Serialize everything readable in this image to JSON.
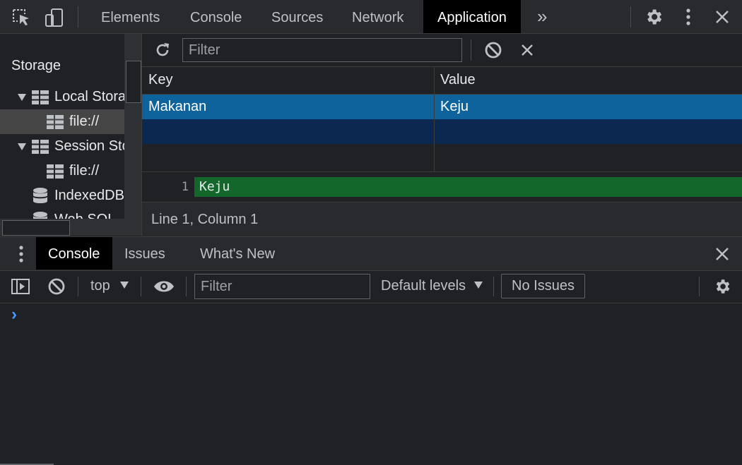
{
  "toolbar": {
    "tabs": [
      {
        "label": "Elements"
      },
      {
        "label": "Console"
      },
      {
        "label": "Sources"
      },
      {
        "label": "Network"
      },
      {
        "label": "Application"
      }
    ],
    "active_tab": "Application",
    "more_tabs_glyph": "»",
    "icons": [
      "select-element-icon",
      "device-toggle-icon",
      "settings-icon",
      "more-options-icon",
      "close-icon"
    ]
  },
  "sidebar": {
    "section_title": "Storage",
    "items": [
      {
        "label": "Local Storage",
        "icon": "table-icon",
        "expanded": true
      },
      {
        "label": "file://",
        "icon": "table-icon",
        "selected": true
      },
      {
        "label": "Session Storage",
        "icon": "table-icon",
        "expanded": true
      },
      {
        "label": "file://",
        "icon": "table-icon"
      },
      {
        "label": "IndexedDB",
        "icon": "database-icon"
      },
      {
        "label": "Web SQL",
        "icon": "database-icon"
      }
    ]
  },
  "storage_panel": {
    "filter_placeholder": "Filter",
    "columns": {
      "key": "Key",
      "value": "Value"
    },
    "rows": [
      {
        "key": "Makanan",
        "value": "Keju",
        "selected": true
      }
    ],
    "preview": {
      "line_number": "1",
      "content": "Keju"
    },
    "status": "Line 1, Column 1"
  },
  "drawer": {
    "tabs": [
      {
        "label": "Console"
      },
      {
        "label": "Issues"
      },
      {
        "label": "What's New"
      }
    ],
    "active_tab": "Console",
    "context": "top",
    "filter_placeholder": "Filter",
    "levels": "Default levels",
    "issues_button": "No Issues",
    "prompt": "›"
  },
  "colors": {
    "selected_row": "#0e639c",
    "stripe_row": "#0b2850",
    "preview_bg": "#14672a",
    "prompt": "#4d9aff"
  }
}
